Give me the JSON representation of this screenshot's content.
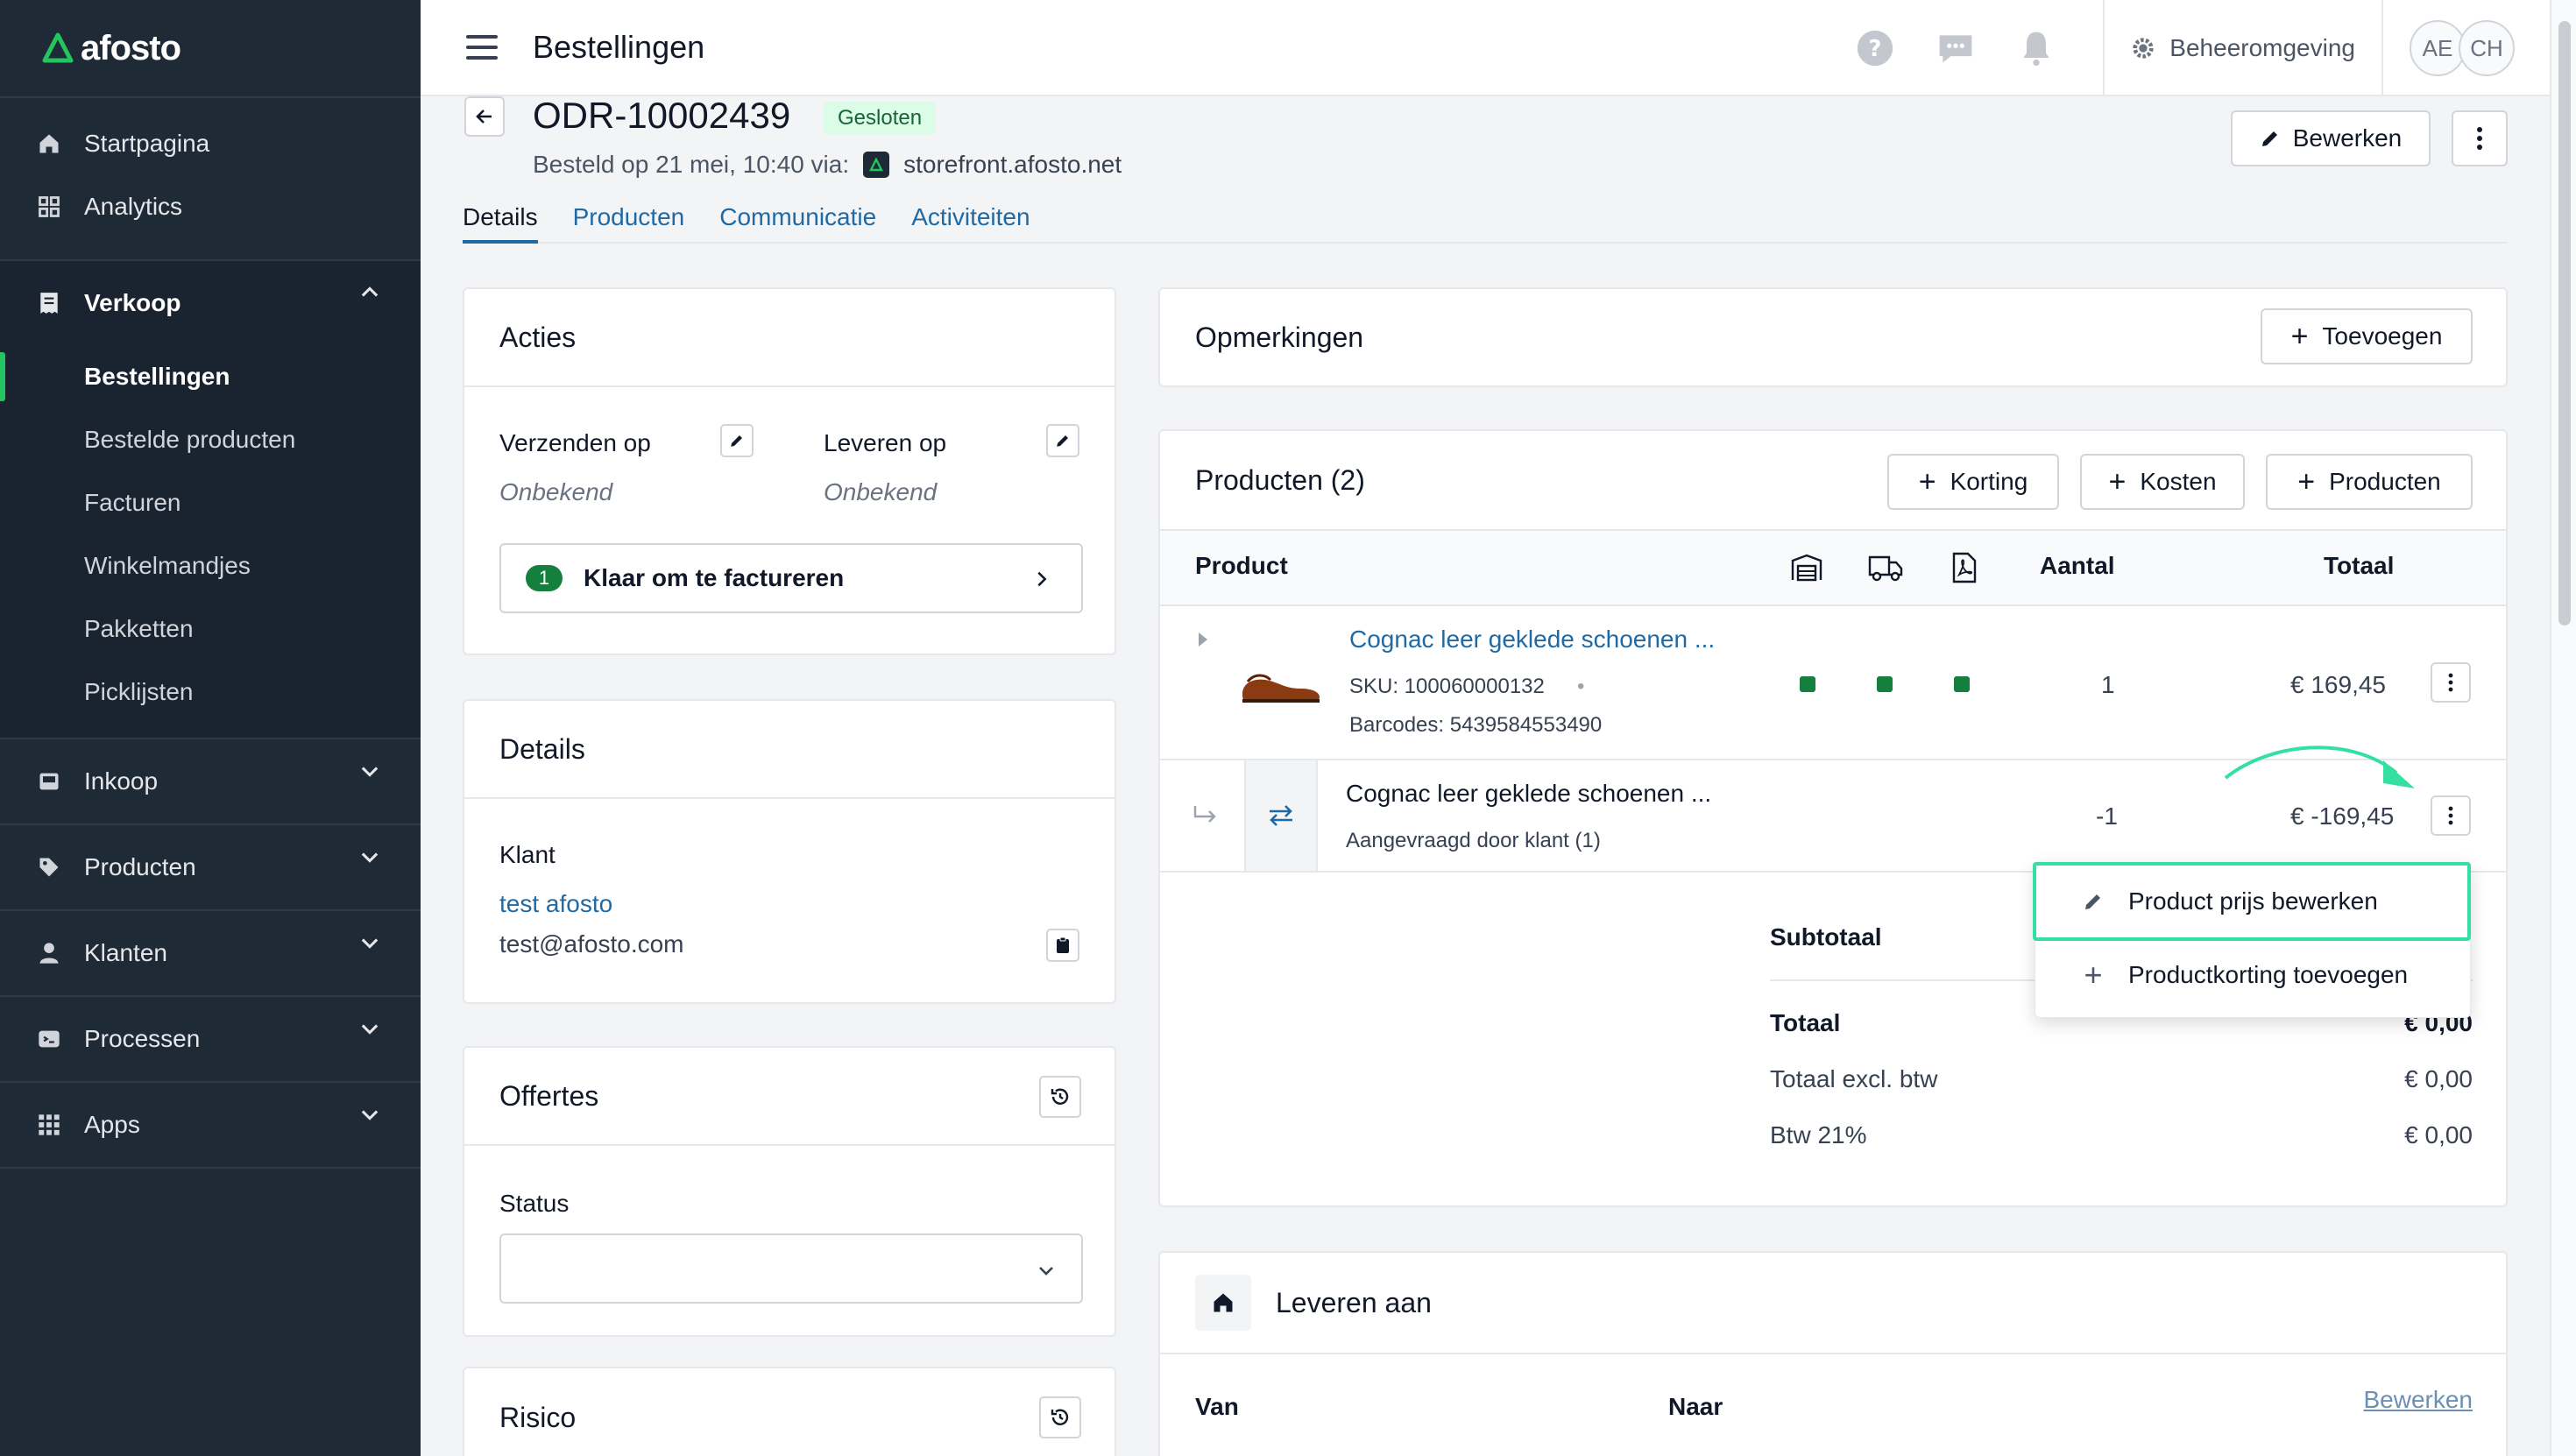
{
  "app": {
    "logo": "afosto",
    "page_title": "Bestellingen"
  },
  "sidebar": {
    "top": [
      {
        "label": "Startpagina",
        "icon": "home-icon"
      },
      {
        "label": "Analytics",
        "icon": "grid-icon"
      }
    ],
    "verkoop": {
      "label": "Verkoop",
      "items": [
        "Bestellingen",
        "Bestelde producten",
        "Facturen",
        "Winkelmandjes",
        "Pakketten",
        "Picklijsten"
      ],
      "active": "Bestellingen"
    },
    "groups": [
      {
        "label": "Inkoop",
        "icon": "inbox-icon"
      },
      {
        "label": "Producten",
        "icon": "tag-icon"
      },
      {
        "label": "Klanten",
        "icon": "user-icon"
      },
      {
        "label": "Processen",
        "icon": "process-icon"
      },
      {
        "label": "Apps",
        "icon": "apps-icon"
      }
    ]
  },
  "topbar": {
    "beheer": "Beheeromgeving",
    "avatars": [
      "AE",
      "CH"
    ]
  },
  "order": {
    "id": "ODR-10002439",
    "status": "Gesloten",
    "meta_prefix": "Besteld op 21 mei, 10:40 via:",
    "store": "storefront.afosto.net",
    "edit_label": "Bewerken"
  },
  "tabs": [
    "Details",
    "Producten",
    "Communicatie",
    "Activiteiten"
  ],
  "acties": {
    "title": "Acties",
    "ship_label": "Verzenden op",
    "ship_value": "Onbekend",
    "deliver_label": "Leveren op",
    "deliver_value": "Onbekend",
    "step_number": "1",
    "step_label": "Klaar om te factureren"
  },
  "details": {
    "title": "Details",
    "customer_label": "Klant",
    "customer_name": "test afosto",
    "customer_email": "test@afosto.com"
  },
  "offertes": {
    "title": "Offertes",
    "status_label": "Status"
  },
  "risico": {
    "title": "Risico"
  },
  "opmerkingen": {
    "title": "Opmerkingen",
    "add_label": "Toevoegen"
  },
  "producten": {
    "title": "Producten (2)",
    "buttons": [
      "Korting",
      "Kosten",
      "Producten"
    ],
    "headers": {
      "product": "Product",
      "aantal": "Aantal",
      "totaal": "Totaal"
    },
    "rows": [
      {
        "name": "Cognac leer geklede schoenen ...",
        "sku": "SKU: 100060000132",
        "barcodes": "Barcodes: 5439584553490",
        "qty": "1",
        "total": "€ 169,45"
      },
      {
        "name": "Cognac leer geklede schoenen ...",
        "sub": "Aangevraagd door klant (1)",
        "qty": "-1",
        "total": "€ -169,45"
      }
    ],
    "summary": {
      "subtotaal_label": "Subtotaal",
      "totaal_label": "Totaal",
      "totaal_value": "€ 0,00",
      "excl_label": "Totaal excl. btw",
      "excl_value": "€ 0,00",
      "btw_label": "Btw 21%",
      "btw_value": "€ 0,00"
    },
    "menu": [
      "Product prijs bewerken",
      "Productkorting toevoegen"
    ]
  },
  "leveren": {
    "title": "Leveren aan",
    "van_label": "Van",
    "naar_label": "Naar",
    "edit_label": "Bewerken"
  },
  "colors": {
    "sidebar": "#1f2a37",
    "accent": "#1f6aa5",
    "success": "#15803d",
    "highlight": "#34e0a1"
  }
}
